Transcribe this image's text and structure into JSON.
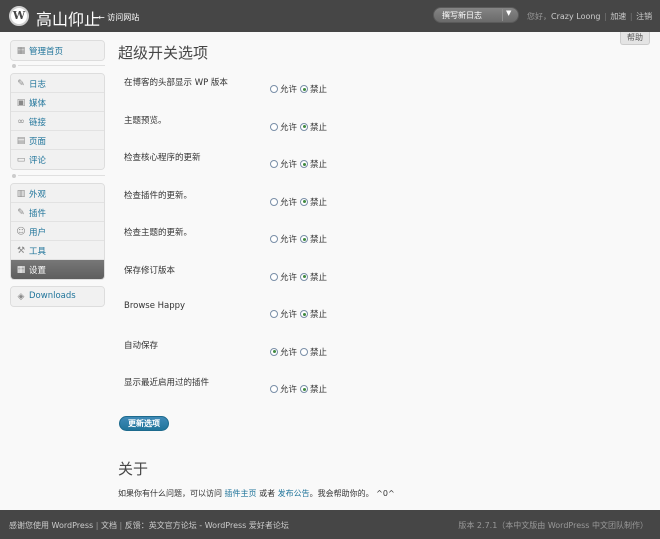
{
  "header": {
    "site_title": "高山仰止",
    "visit_site": "← 访问网站",
    "favorite_label": "撰写新日志",
    "favorite_arrow": "▼",
    "greeting": "您好，",
    "username": "Crazy Loong",
    "sep": "|",
    "dashboard_link": "加速",
    "logout_link": "注销"
  },
  "help_label": "帮助",
  "sidebar": {
    "groups": [
      {
        "items": [
          {
            "label": "管理首页",
            "icon": "dashboard-icon",
            "glyph": "▦"
          }
        ]
      },
      {
        "items": [
          {
            "label": "日志",
            "icon": "pin-icon",
            "glyph": "✎"
          },
          {
            "label": "媒体",
            "icon": "media-icon",
            "glyph": "▣"
          },
          {
            "label": "链接",
            "icon": "link-icon",
            "glyph": "∞"
          },
          {
            "label": "页面",
            "icon": "page-icon",
            "glyph": "▤"
          },
          {
            "label": "评论",
            "icon": "comment-icon",
            "glyph": "▭"
          }
        ]
      },
      {
        "items": [
          {
            "label": "外观",
            "icon": "appearance-icon",
            "glyph": "▥"
          },
          {
            "label": "插件",
            "icon": "plugin-icon",
            "glyph": "✎"
          },
          {
            "label": "用户",
            "icon": "users-icon",
            "glyph": "☺"
          },
          {
            "label": "工具",
            "icon": "tools-icon",
            "glyph": "⚒"
          },
          {
            "label": "设置",
            "icon": "settings-icon",
            "glyph": "▦"
          }
        ]
      },
      {
        "items": [
          {
            "label": "Downloads",
            "icon": "downloads-icon",
            "glyph": "◈"
          }
        ]
      }
    ]
  },
  "main": {
    "title": "超级开关选项",
    "allow_label": "允许",
    "deny_label": "禁止",
    "options": [
      {
        "label": "在博客的头部显示 WP 版本",
        "value": "deny"
      },
      {
        "label": "主题预览。",
        "value": "deny"
      },
      {
        "label": "检查核心程序的更新",
        "value": "deny"
      },
      {
        "label": "检查插件的更新。",
        "value": "deny"
      },
      {
        "label": "检查主题的更新。",
        "value": "deny"
      },
      {
        "label": "保存修订版本",
        "value": "deny"
      },
      {
        "label": "Browse Happy",
        "value": "deny"
      },
      {
        "label": "自动保存",
        "value": "allow"
      },
      {
        "label": "显示最近启用过的插件",
        "value": "deny"
      }
    ],
    "save_label": "更新选项",
    "about_title": "关于",
    "about_text_1": "如果你有什么问题，可以访问 ",
    "about_link_1": "插件主页",
    "about_text_2": " 或者 ",
    "about_link_2": "发布公告",
    "about_text_3": "。我会帮助你的。 ^0^"
  },
  "footer": {
    "thanks": "感谢您使用 WordPress",
    "docs": "文档",
    "feedback": "反馈：英文官方论坛 - WordPress 爱好者论坛",
    "version": "版本 2.7.1（本中文版由 WordPress 中文团队制作）",
    "sep": "|"
  }
}
